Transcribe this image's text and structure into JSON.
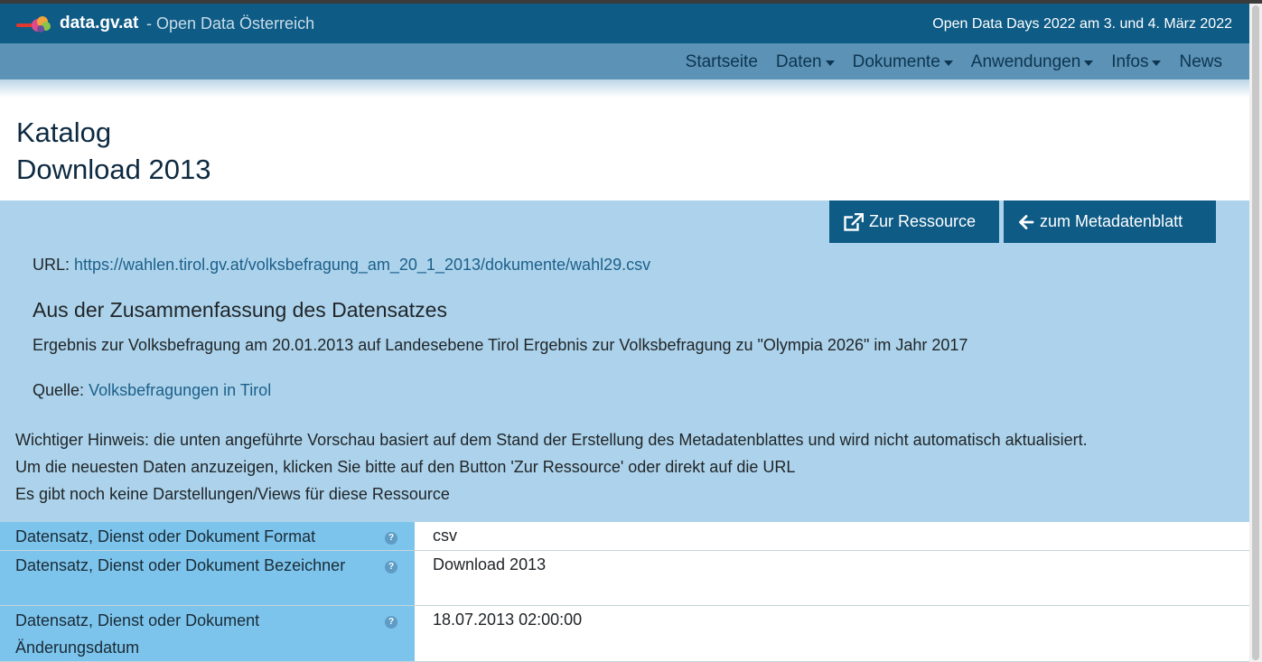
{
  "header": {
    "brand": "data.gv.at",
    "subtitle": "- Open Data Österreich",
    "announcement": "Open Data Days 2022 am 3. und 4. März 2022"
  },
  "nav": {
    "items": [
      {
        "label": "Startseite"
      },
      {
        "label": "Daten"
      },
      {
        "label": "Dokumente"
      },
      {
        "label": "Anwendungen"
      },
      {
        "label": "Infos"
      },
      {
        "label": "News"
      }
    ]
  },
  "page": {
    "title_line1": "Katalog",
    "title_line2": "Download 2013"
  },
  "actions": {
    "resource_label": "Zur Ressource",
    "metadata_label": "zum Metadatenblatt"
  },
  "resource": {
    "url_label": "URL:",
    "url": "https://wahlen.tirol.gv.at/volksbefragung_am_20_1_2013/dokumente/wahl29.csv",
    "summary_heading": "Aus der Zusammenfassung des Datensatzes",
    "summary_text": "Ergebnis zur Volksbefragung am 20.01.2013 auf Landesebene Tirol Ergebnis zur Volksbefragung zu \"Olympia 2026\" im Jahr 2017",
    "source_label": "Quelle:",
    "source_link": "Volksbefragungen in Tirol"
  },
  "notes": {
    "line1": "Wichtiger Hinweis: die unten angeführte Vorschau basiert auf dem Stand der Erstellung des Metadatenblattes und wird nicht automatisch aktualisiert.",
    "line2": "Um die neuesten Daten anzuzeigen, klicken Sie bitte auf den Button 'Zur Ressource' oder direkt auf die URL",
    "line3": "Es gibt noch keine Darstellungen/Views für diese Ressource"
  },
  "metadata": {
    "rows": [
      {
        "key": "Datensatz, Dienst oder Dokument Format",
        "value": "csv"
      },
      {
        "key": "Datensatz, Dienst oder Dokument Bezeichner",
        "value": "Download 2013"
      },
      {
        "key": "Datensatz, Dienst oder Dokument Änderungsdatum",
        "value": "18.07.2013 02:00:00"
      }
    ],
    "help_glyph": "?"
  },
  "colors": {
    "brand_bar": "#0e5b86",
    "nav_bar": "#5b92b5",
    "panel": "#acd3eb",
    "key_cell": "#7cc4ec",
    "link": "#1d5f8a"
  }
}
